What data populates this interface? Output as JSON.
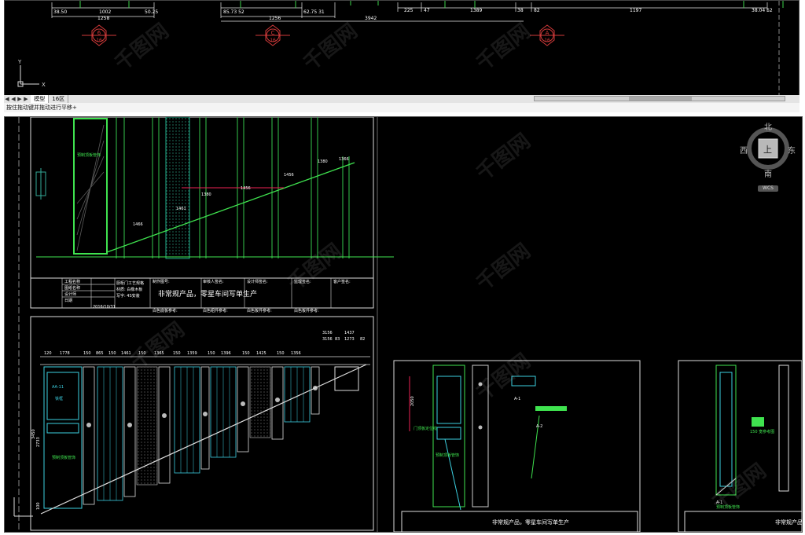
{
  "top_viewport": {
    "dims": [
      "38.50",
      "1002",
      "50.25",
      "1258",
      "85.73 52",
      "1256",
      "62.75 31",
      "3942",
      "225",
      "47",
      "1389",
      "38",
      "82",
      "1197",
      "38.04 52"
    ],
    "markers": [
      {
        "top": "6",
        "bottom": "16",
        "color": "#d23a3a"
      },
      {
        "top": "C",
        "bottom": "16",
        "color": "#d23a3a"
      },
      {
        "top": "A",
        "bottom": "16",
        "color": "#d23a3a"
      }
    ],
    "ucs": {
      "x": "X",
      "y": "Y"
    }
  },
  "tabbar": {
    "nav": [
      "◀",
      "◀",
      "▶",
      "▶"
    ],
    "tabs": [
      "模型",
      "16区"
    ],
    "active_tab": 0
  },
  "command_line": {
    "text": "按住拖动键并拖动进行平移+"
  },
  "compass": {
    "north": "北",
    "south": "南",
    "east": "东",
    "west": "西",
    "center": "上",
    "wcs": "WCS"
  },
  "drawing": {
    "section1_dims": [
      "1466",
      "1461",
      "1380",
      "1456",
      "1456",
      "1380",
      "1366"
    ],
    "section1_label": "预制顶板管饰",
    "title_block": {
      "header": [
        "工程名称",
        "图纸名称",
        "设计师",
        "日期"
      ],
      "date": "2016/10/31",
      "col2": [
        "厨柜门工艺规格",
        "材质: 白橡木板",
        "写字: 4S安装"
      ],
      "note_main": "非常规产品，零星车间写单生产",
      "cols": [
        "制作图号:",
        "审核人签名:",
        "设计师签名:",
        "监理签名:",
        "客户签名:",
        "批准人签名:"
      ],
      "bottom": [
        "白色底板参考:",
        "白色组件参考:",
        "白色板件参考:",
        "白色板件参考:"
      ]
    },
    "section2_dims_top": [
      "120",
      "1778",
      "150",
      "865",
      "150",
      "1461",
      "150",
      "1365",
      "150",
      "1359",
      "150",
      "1396",
      "150",
      "1425",
      "150",
      "1356"
    ],
    "section2_dims_right": [
      "3156",
      "1437",
      "3156",
      "83",
      "1273",
      "82"
    ],
    "section2_labels": [
      "AA-11",
      "铁框",
      "预制顶板管饰"
    ],
    "section2_heights": [
      "3450",
      "2733",
      "100"
    ],
    "section3_labels": [
      "A-1",
      "A-2",
      "预制顶板管饰",
      "门顶板定位线"
    ],
    "section3_height": "2050",
    "section4_labels": [
      "A-1",
      "150 宽参考图",
      "预制顶板管饰"
    ],
    "note_short": "非常规产品，零星车间写单生产"
  },
  "watermark": "千图网"
}
